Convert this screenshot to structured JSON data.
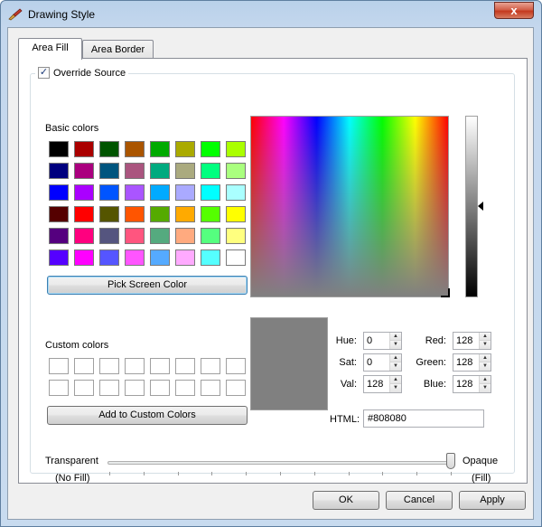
{
  "window": {
    "title": "Drawing Style",
    "close_glyph": "x",
    "title_icon": "paint-brush-icon"
  },
  "tabs": [
    {
      "label": "Area Fill",
      "active": true
    },
    {
      "label": "Area Border",
      "active": false
    }
  ],
  "override_source": {
    "label": "Override Source",
    "checked": true
  },
  "basic_colors": {
    "label": "Basic colors",
    "rows": [
      [
        "#000000",
        "#aa0000",
        "#005500",
        "#aa5500",
        "#00aa00",
        "#aaaa00",
        "#00ff00",
        "#aaff00"
      ],
      [
        "#00007f",
        "#aa007f",
        "#00557f",
        "#aa557f",
        "#00aa7f",
        "#aaaa7f",
        "#00ff7f",
        "#aaff7f"
      ],
      [
        "#0000ff",
        "#aa00ff",
        "#0055ff",
        "#aa55ff",
        "#00aaff",
        "#aaaaff",
        "#00ffff",
        "#aaffff"
      ],
      [
        "#550000",
        "#ff0000",
        "#555500",
        "#ff5500",
        "#55aa00",
        "#ffaa00",
        "#55ff00",
        "#ffff00"
      ],
      [
        "#55007f",
        "#ff007f",
        "#55557f",
        "#ff557f",
        "#55aa7f",
        "#ffaa7f",
        "#55ff7f",
        "#ffff7f"
      ],
      [
        "#5500ff",
        "#ff00ff",
        "#5555ff",
        "#ff55ff",
        "#55aaff",
        "#ffaaff",
        "#55ffff",
        "#ffffff"
      ]
    ]
  },
  "pick_screen_color_label": "Pick Screen Color",
  "custom_colors": {
    "label": "Custom colors"
  },
  "add_custom_label": "Add to Custom Colors",
  "fields": {
    "hue": {
      "label": "Hue:",
      "value": "0"
    },
    "sat": {
      "label": "Sat:",
      "value": "0"
    },
    "val": {
      "label": "Val:",
      "value": "128"
    },
    "red": {
      "label": "Red:",
      "value": "128"
    },
    "green": {
      "label": "Green:",
      "value": "128"
    },
    "blue": {
      "label": "Blue:",
      "value": "128"
    },
    "html": {
      "label": "HTML:",
      "value": "#808080"
    }
  },
  "current_color": "#808080",
  "opacity": {
    "left_label": "Transparent",
    "left_sub": "(No Fill)",
    "right_label": "Opaque",
    "right_sub": "(Fill)",
    "level": 1.0
  },
  "buttons": {
    "ok": "OK",
    "cancel": "Cancel",
    "apply": "Apply"
  }
}
